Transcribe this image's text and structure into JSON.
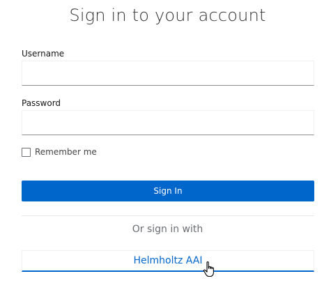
{
  "page": {
    "title": "Sign in to your account"
  },
  "form": {
    "username_label": "Username",
    "username_value": "",
    "password_label": "Password",
    "password_value": "",
    "remember_label": "Remember me",
    "remember_checked": false,
    "submit_label": "Sign In"
  },
  "providers": {
    "separator_text": "Or sign in with",
    "items": [
      {
        "label": "Helmholtz AAI"
      }
    ]
  },
  "colors": {
    "primary": "#0066cc",
    "text": "#151515",
    "muted": "#6a6e73"
  },
  "icons": {
    "cursor": "hand-pointer-icon"
  }
}
